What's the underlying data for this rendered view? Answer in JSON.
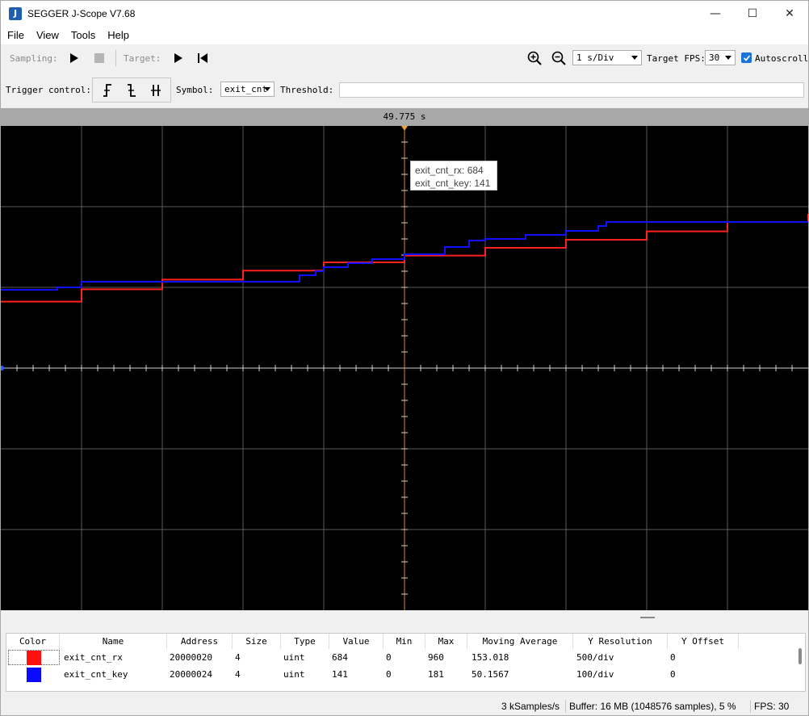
{
  "window": {
    "title": "SEGGER J-Scope V7.68",
    "app_icon": "J",
    "minimize": "—",
    "maximize": "☐",
    "close": "✕"
  },
  "menu": [
    "File",
    "View",
    "Tools",
    "Help"
  ],
  "toolbar": {
    "sampling_label": "Sampling:",
    "target_label": "Target:",
    "time_div": "1 s/Div",
    "target_fps_label": "Target FPS:",
    "target_fps": "30",
    "autoscroll_label": "Autoscroll",
    "autoscroll_checked": true
  },
  "trigger": {
    "label": "Trigger control:",
    "symbol_label": "Symbol:",
    "symbol_value": "exit_cnt",
    "threshold_label": "Threshold:",
    "threshold_value": "",
    "rising_icon": "trigger-rising-icon",
    "falling_icon": "trigger-falling-icon",
    "both_icon": "trigger-both-icon"
  },
  "scope": {
    "cursor_time": "49.775 s",
    "background": "#000000",
    "grid_color": "#5a5a5a",
    "cursor_color": "#d08a3a",
    "tooltip": {
      "line1": "exit_cnt_rx: 684",
      "line2": "exit_cnt_key: 141"
    }
  },
  "chart_data": {
    "type": "line",
    "series": [
      {
        "name": "exit_cnt_rx",
        "color": "#ff2020",
        "resolution_per_div": 500,
        "points": [
          [
            0,
            412
          ],
          [
            100,
            488
          ],
          [
            200,
            548
          ],
          [
            300,
            604
          ],
          [
            400,
            655
          ],
          [
            500,
            697
          ],
          [
            600,
            745
          ],
          [
            700,
            795
          ],
          [
            800,
            847
          ],
          [
            900,
            905
          ],
          [
            1000,
            955
          ]
        ]
      },
      {
        "name": "exit_cnt_key",
        "color": "#1010ff",
        "resolution_per_div": 100,
        "points": [
          [
            0,
            97
          ],
          [
            70,
            100
          ],
          [
            100,
            107
          ],
          [
            150,
            107
          ],
          [
            300,
            107
          ],
          [
            365,
            107
          ],
          [
            370,
            115
          ],
          [
            390,
            120
          ],
          [
            400,
            125
          ],
          [
            430,
            130
          ],
          [
            460,
            135
          ],
          [
            500,
            141
          ],
          [
            550,
            150
          ],
          [
            580,
            158
          ],
          [
            600,
            160
          ],
          [
            650,
            165
          ],
          [
            700,
            170
          ],
          [
            740,
            176
          ],
          [
            750,
            181
          ],
          [
            1000,
            181
          ]
        ]
      }
    ]
  },
  "table": {
    "headers": [
      "Color",
      "Name",
      "Address",
      "Size",
      "Type",
      "Value",
      "Min",
      "Max",
      "Moving Average",
      "Y Resolution",
      "Y Offset"
    ],
    "rows": [
      {
        "color": "#ff1010",
        "name": "exit_cnt_rx",
        "address": "20000020",
        "size": "4",
        "type": "uint",
        "value": "684",
        "min": "0",
        "max": "960",
        "moving_average": "153.018",
        "y_resolution": "500/div",
        "y_offset": "0"
      },
      {
        "color": "#0a0aff",
        "name": "exit_cnt_key",
        "address": "20000024",
        "size": "4",
        "type": "uint",
        "value": "141",
        "min": "0",
        "max": "181",
        "moving_average": "50.1567",
        "y_resolution": "100/div",
        "y_offset": "0"
      }
    ]
  },
  "status": {
    "rate": "3 kSamples/s",
    "buffer": "Buffer: 16 MB (1048576 samples), 5 %",
    "fps": "FPS: 30"
  }
}
